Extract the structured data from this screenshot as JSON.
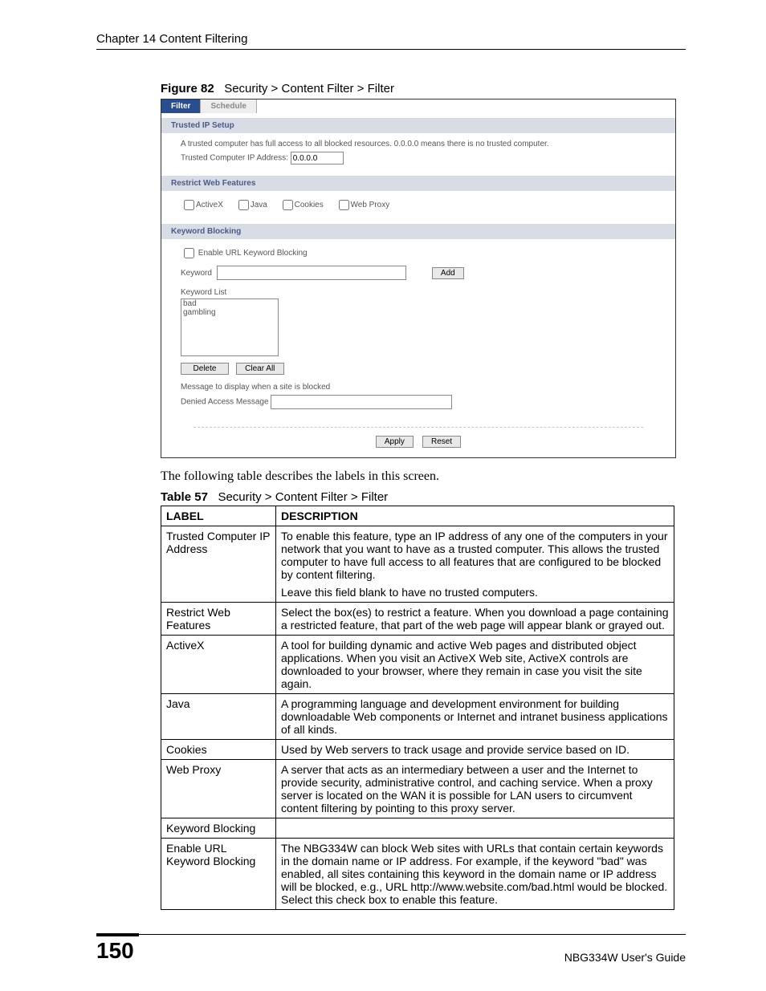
{
  "header": {
    "chapter": "Chapter 14 Content Filtering"
  },
  "figure": {
    "label": "Figure 82",
    "title": "Security > Content Filter > Filter"
  },
  "ui": {
    "tabs": {
      "filter": "Filter",
      "schedule": "Schedule"
    },
    "trusted": {
      "header": "Trusted IP Setup",
      "desc": "A trusted computer has full access to all blocked resources. 0.0.0.0 means there is no trusted computer.",
      "ip_label": "Trusted Computer IP Address:",
      "ip_value": "0.0.0.0"
    },
    "restrict": {
      "header": "Restrict Web Features",
      "activex": "ActiveX",
      "java": "Java",
      "cookies": "Cookies",
      "webproxy": "Web Proxy"
    },
    "keyword": {
      "header": "Keyword Blocking",
      "enable": "Enable URL Keyword Blocking",
      "kw_label": "Keyword",
      "add": "Add",
      "list_label": "Keyword List",
      "items": [
        "bad",
        "gambling"
      ],
      "delete": "Delete",
      "clear": "Clear All",
      "msg_label": "Message to display when a site is blocked",
      "denied_label": "Denied Access Message"
    },
    "buttons": {
      "apply": "Apply",
      "reset": "Reset"
    }
  },
  "body_text": "The following table describes the labels in this screen.",
  "table": {
    "label": "Table 57",
    "title": "Security > Content Filter > Filter",
    "col_label": "LABEL",
    "col_desc": "DESCRIPTION",
    "rows": [
      {
        "label": "Trusted Computer IP Address",
        "desc": "To enable this feature, type an IP address of any one of the computers in your network that you want to have as a trusted computer. This allows the trusted computer to have full access to all features that are configured to be blocked by content filtering.\nLeave this field blank to have no trusted computers."
      },
      {
        "label": "Restrict Web Features",
        "desc": "Select the box(es) to restrict a feature. When you download a page containing a restricted feature, that part of the web page will appear blank or grayed out."
      },
      {
        "label": "ActiveX",
        "desc": "A tool for building dynamic and active Web pages and distributed object applications. When you visit an ActiveX Web site, ActiveX controls are downloaded to your browser, where they remain in case you visit the site again."
      },
      {
        "label": "Java",
        "desc": "A programming language and development environment for building downloadable Web components or Internet and intranet business applications of all kinds."
      },
      {
        "label": "Cookies",
        "desc": "Used by Web servers to track usage and provide service based on ID."
      },
      {
        "label": "Web Proxy",
        "desc": "A server that acts as an intermediary between a user and the Internet to provide security, administrative control, and caching service. When a proxy server is located on the WAN it is possible for LAN users to circumvent content filtering by pointing to this proxy server."
      },
      {
        "label": "Keyword Blocking",
        "desc": ""
      },
      {
        "label": "Enable URL Keyword Blocking",
        "desc": "The NBG334W can block Web sites with URLs that contain certain keywords in the domain name or IP address. For example, if the keyword \"bad\" was enabled, all sites containing this keyword in the domain name or IP address will be blocked, e.g., URL http://www.website.com/bad.html would be blocked. Select this check box to enable this feature."
      }
    ]
  },
  "footer": {
    "page": "150",
    "guide": "NBG334W User's Guide"
  }
}
